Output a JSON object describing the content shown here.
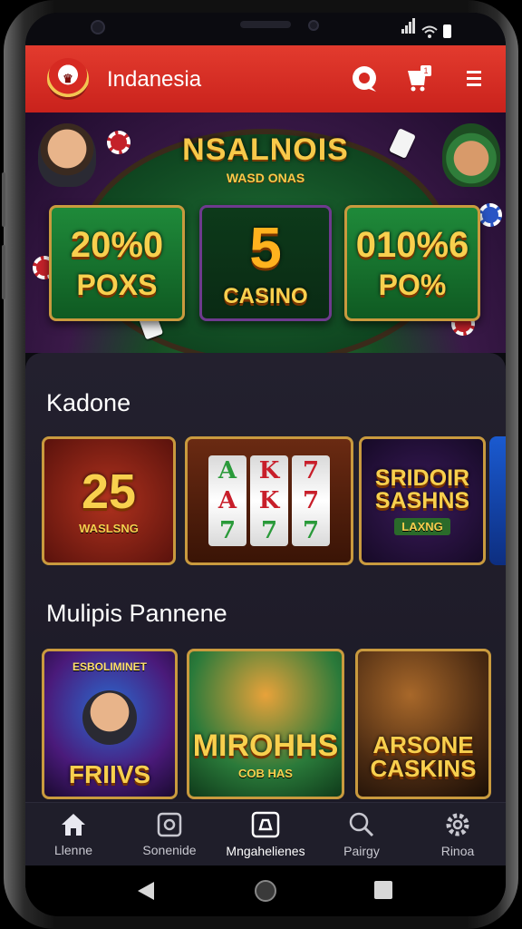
{
  "app": {
    "title": "Indanesia"
  },
  "banner": {
    "title": "NSALNOIS",
    "subtitle": "WASD ONAS",
    "promos": [
      {
        "big": "20%0",
        "small": "POXS"
      },
      {
        "big": "5",
        "small": "CASINO"
      },
      {
        "big": "010%6",
        "small": "PO%"
      }
    ]
  },
  "sections": [
    {
      "title": "Kadone",
      "tiles": [
        {
          "big": "25",
          "sub": "WASLSNG"
        },
        {
          "reels": [
            [
              "A",
              "A",
              "7"
            ],
            [
              "K",
              "K",
              "7"
            ],
            [
              "7",
              "7",
              "7"
            ]
          ]
        },
        {
          "big": "SRIDOIR SASHNS",
          "sub": "LAXNG"
        }
      ]
    },
    {
      "title": "Mulipis Pannene",
      "tiles": [
        {
          "top": "ESBOLIMINET",
          "big": "FRIIVS"
        },
        {
          "big": "MIROHHS",
          "sub": "COB HAS"
        },
        {
          "big": "ARSONE CASKINS"
        }
      ]
    }
  ],
  "nav": [
    {
      "label": "Llenne",
      "icon": "home-icon"
    },
    {
      "label": "Sonenide",
      "icon": "square-icon"
    },
    {
      "label": "Mngahelienes",
      "icon": "camera-icon"
    },
    {
      "label": "Pairgy",
      "icon": "search-icon"
    },
    {
      "label": "Rinoa",
      "icon": "gear-icon"
    }
  ],
  "colors": {
    "header": "#d62a22",
    "gold": "#f8d04e",
    "nav_bg": "#1f1e2a"
  }
}
